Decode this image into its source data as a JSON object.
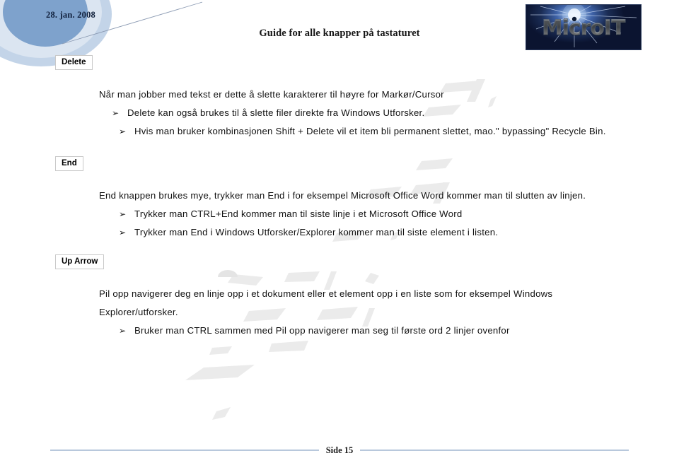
{
  "document": {
    "header": {
      "date": "28. jan. 2008",
      "title": "Guide for alle knapper på tastaturet",
      "logo_text": "MicroIT"
    },
    "footer": {
      "page_label": "Side 15"
    },
    "sections": [
      {
        "key_label": "Delete",
        "paragraphs": [
          "Når man jobber med tekst er dette å slette karakterer til høyre for Markør/Cursor"
        ],
        "bullets": [
          "Delete kan også brukes til å slette filer direkte fra Windows Utforsker.",
          "Hvis man bruker kombinasjonen Shift + Delete vil et item bli permanent slettet, mao.\" bypassing\" Recycle Bin."
        ]
      },
      {
        "key_label": "End",
        "paragraphs": [
          "End knappen brukes mye, trykker man End i for eksempel Microsoft Office Word kommer man til slutten av linjen."
        ],
        "bullets": [
          "Trykker man CTRL+End kommer man til siste linje i et Microsoft Office Word",
          "Trykker man End i Windows Utforsker/Explorer kommer man til siste element i listen."
        ]
      },
      {
        "key_label": "Up Arrow",
        "paragraphs": [
          "Pil opp navigerer deg en linje opp i et dokument eller et element opp i en liste som for eksempel Windows Explorer/utforsker."
        ],
        "bullets": [
          "Bruker man CTRL sammen med Pil opp navigerer man seg til første ord 2 linjer ovenfor"
        ]
      }
    ],
    "bullet_glyph": "➢",
    "colors": {
      "circle_outer": "#c3d4e8",
      "circle_mid": "#dbe5f1",
      "circle_inner": "#7ea2cc",
      "footer_rule": "#b8c8dc",
      "logo_background": "#16284d",
      "badge_border": "#c9c9c9",
      "watermark": "#ebebeb"
    }
  }
}
